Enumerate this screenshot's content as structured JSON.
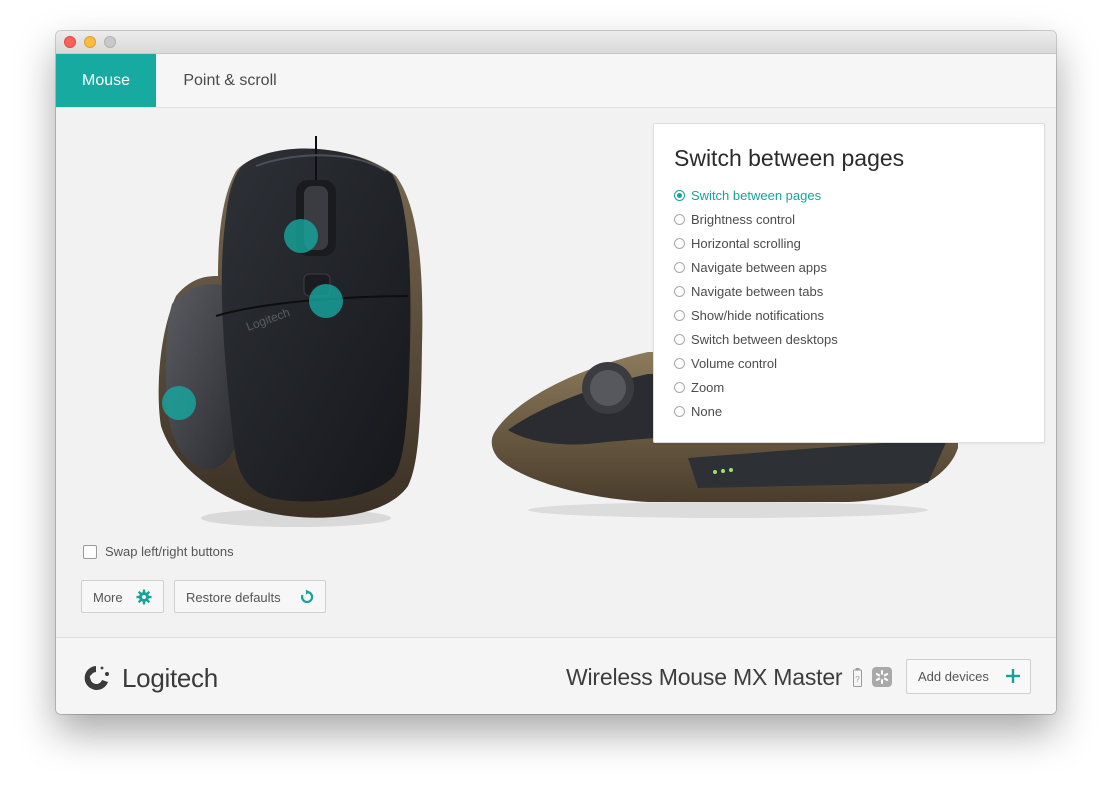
{
  "tabs": [
    {
      "label": "Mouse",
      "active": true
    },
    {
      "label": "Point & scroll",
      "active": false
    }
  ],
  "panel": {
    "title": "Switch between pages",
    "options": [
      {
        "label": "Switch between pages",
        "selected": true
      },
      {
        "label": "Brightness control",
        "selected": false
      },
      {
        "label": "Horizontal scrolling",
        "selected": false
      },
      {
        "label": "Navigate between apps",
        "selected": false
      },
      {
        "label": "Navigate between tabs",
        "selected": false
      },
      {
        "label": "Show/hide notifications",
        "selected": false
      },
      {
        "label": "Switch between desktops",
        "selected": false
      },
      {
        "label": "Volume control",
        "selected": false
      },
      {
        "label": "Zoom",
        "selected": false
      },
      {
        "label": "None",
        "selected": false
      }
    ]
  },
  "mouse_image": {
    "brand_text": "Logitech"
  },
  "swap_buttons": {
    "label": "Swap left/right buttons",
    "checked": false
  },
  "buttons": {
    "more": {
      "label": "More",
      "icon": "gear-icon"
    },
    "restore": {
      "label": "Restore defaults",
      "icon": "restore-icon"
    }
  },
  "footer": {
    "logo_text": "Logitech",
    "device_name": "Wireless Mouse MX Master",
    "add_devices_label": "Add devices"
  },
  "colors": {
    "accent": "#16aaa1",
    "background": "#f2f2f2"
  }
}
